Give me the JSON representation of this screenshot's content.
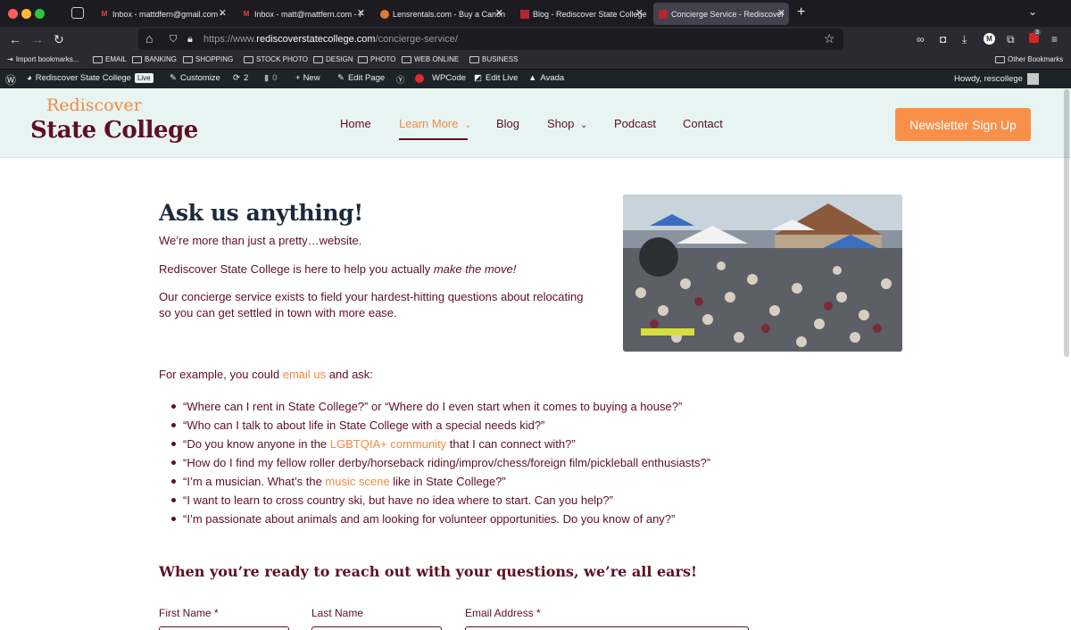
{
  "browser": {
    "tabs": [
      {
        "title": "Inbox - mattdfern@gmail.com -",
        "favicon": "gmail-icon"
      },
      {
        "title": "Inbox - matt@mattfern.com - F",
        "favicon": "gmail-icon"
      },
      {
        "title": "Lensrentals.com - Buy a Canon",
        "favicon": "lensrentals-icon"
      },
      {
        "title": "Blog - Rediscover State College",
        "favicon": "site-icon"
      },
      {
        "title": "Concierge Service - Rediscover",
        "favicon": "site-icon",
        "active": true
      }
    ],
    "url_prefix": "https://www.",
    "url_domain": "rediscoverstatecollege.com",
    "url_path": "/concierge-service/",
    "extension_badge": "3"
  },
  "bookmarks": {
    "import": "Import bookmarks...",
    "items": [
      "EMAIL",
      "BANKING",
      "SHOPPING",
      "STOCK PHOTO",
      "DESIGN",
      "PHOTO",
      "WEB ONLINE",
      "BUSINESS"
    ],
    "other": "Other Bookmarks"
  },
  "wp_admin": {
    "site_name": "Rediscover State College",
    "live_badge": "Live",
    "customize": "Customize",
    "updates_count": "2",
    "comments_count": "0",
    "new": "New",
    "edit_page": "Edit Page",
    "wpcode": "WPCode",
    "edit_live": "Edit Live",
    "avada": "Avada",
    "howdy": "Howdy, rescollege"
  },
  "site": {
    "logo_top": "Rediscover",
    "logo_bottom": "State College",
    "menu": {
      "home": "Home",
      "learn_more": "Learn More",
      "blog": "Blog",
      "shop": "Shop",
      "podcast": "Podcast",
      "contact": "Contact"
    },
    "newsletter_button": "Newsletter Sign Up"
  },
  "page": {
    "heading": "Ask us anything!",
    "intro": "We’re more than just a pretty…website.",
    "p2_start": "Rediscover State College is here to help you actually ",
    "p2_em": "make the move!",
    "p3_line1": "Our concierge service exists to field your hardest-hitting questions about relocating",
    "p3_line2": "so you can get settled in town with more ease.",
    "example_start": "For example, you could ",
    "example_link": "email us",
    "example_end": " and ask:",
    "questions": {
      "q1": "“Where can I rent in State College?” or “Where do I even start when it comes to buying a house?”",
      "q2": "“Who can I talk to about life in State College with a special needs kid?”",
      "q3_a": "“Do you know anyone in the ",
      "q3_link": "LGBTQIA+ community",
      "q3_b": " that I can connect with?”",
      "q4": "“How do I find my fellow roller derby/horseback riding/improv/chess/foreign film/pickleball enthusiasts?”",
      "q5_a": "“I’m a musician. What’s the ",
      "q5_link": "music scene",
      "q5_b": " like in State College?”",
      "q6": "“I want to learn to cross country ski, but have no idea where to start. Can you help?”",
      "q7": "“I’m passionate about animals and am looking for volunteer opportunities. Do you know of any?”"
    },
    "form_heading": "When you’re ready to reach out with your questions, we’re all ears!",
    "form": {
      "first_name": "First Name",
      "last_name": "Last Name",
      "email": "Email Address",
      "required_mark": "*"
    }
  },
  "colors": {
    "brand_maroon": "#5f0f23",
    "brand_orange": "#f38a3f",
    "header_bg": "#e8f4f2",
    "button": "#f8904a"
  }
}
